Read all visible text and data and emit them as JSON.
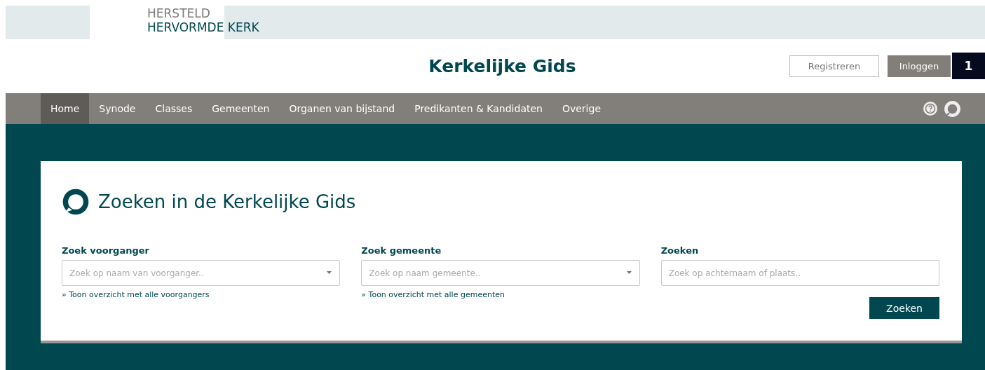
{
  "logo": {
    "line_1": "HERSTELD",
    "line_2": "HERVORMDE KERK"
  },
  "site_title": "Kerkelijke Gids",
  "account_buttons": [
    {
      "label": "Registreren",
      "kind": "outline"
    },
    {
      "label": "Inloggen",
      "kind": "filled"
    }
  ],
  "annotation_badge": "1",
  "nav": {
    "items": [
      {
        "label": "Home",
        "selected": true
      },
      {
        "label": "Synode",
        "selected": false
      },
      {
        "label": "Classes",
        "selected": false
      },
      {
        "label": "Gemeenten",
        "selected": false
      },
      {
        "label": "Organen van bijstand",
        "selected": false
      },
      {
        "label": "Predikanten & Kandidaten",
        "selected": false
      },
      {
        "label": "Overige",
        "selected": false
      }
    ]
  },
  "search_card": {
    "title": "Zoeken in de Kerkelijke Gids",
    "fields": [
      {
        "label": "Zoek voorganger",
        "kind": "dropdown",
        "placeholder": "Zoek op naam van voorganger..",
        "link": "» Toon overzicht met alle voorgangers"
      },
      {
        "label": "Zoek gemeente",
        "kind": "dropdown",
        "placeholder": "Zoek op naam gemeente..",
        "link": "» Toon overzicht met alle gemeenten"
      },
      {
        "label": "Zoeken",
        "kind": "text",
        "placeholder": "Zoek op achternaam of plaats.."
      }
    ],
    "button": "Zoeken"
  }
}
